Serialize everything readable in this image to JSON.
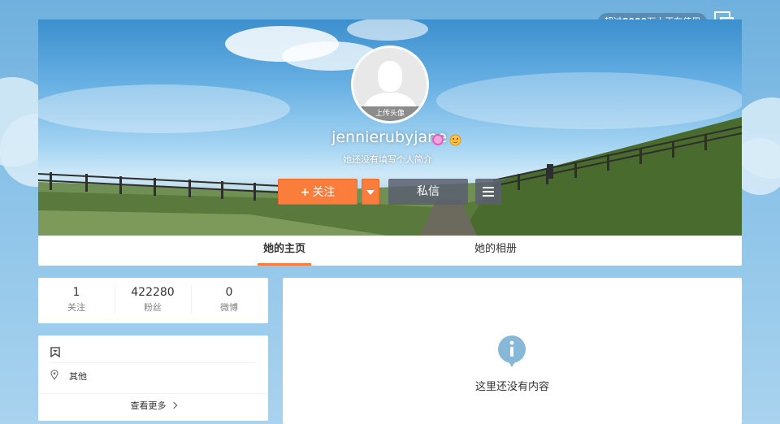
{
  "header": {
    "usage_prefix": "超过",
    "usage_count": "8000",
    "usage_suffix": "万人正在使用"
  },
  "profile": {
    "avatar_upload_label": "上传头像",
    "username": "jennierubyjane",
    "bio": "她还没有填写个人简介",
    "follow_label": "关注",
    "message_label": "私信"
  },
  "tabs": [
    {
      "label": "她的主页",
      "active": true
    },
    {
      "label": "她的相册",
      "active": false
    }
  ],
  "stats": [
    {
      "value": "1",
      "label": "关注"
    },
    {
      "value": "422280",
      "label": "粉丝"
    },
    {
      "value": "0",
      "label": "微博"
    }
  ],
  "info": {
    "location": "其他",
    "more_label": "查看更多"
  },
  "content": {
    "empty_message": "这里还没有内容"
  },
  "colors": {
    "accent": "#fa7d3c",
    "info_icon": "#88b8d8"
  },
  "icons": [
    "skin-icon",
    "user-placeholder-icon",
    "verified-icon",
    "emoji-badge-icon",
    "plus-icon",
    "caret-down-icon",
    "menu-icon",
    "bookmark-icon",
    "location-icon",
    "chevron-right-icon",
    "info-icon"
  ]
}
